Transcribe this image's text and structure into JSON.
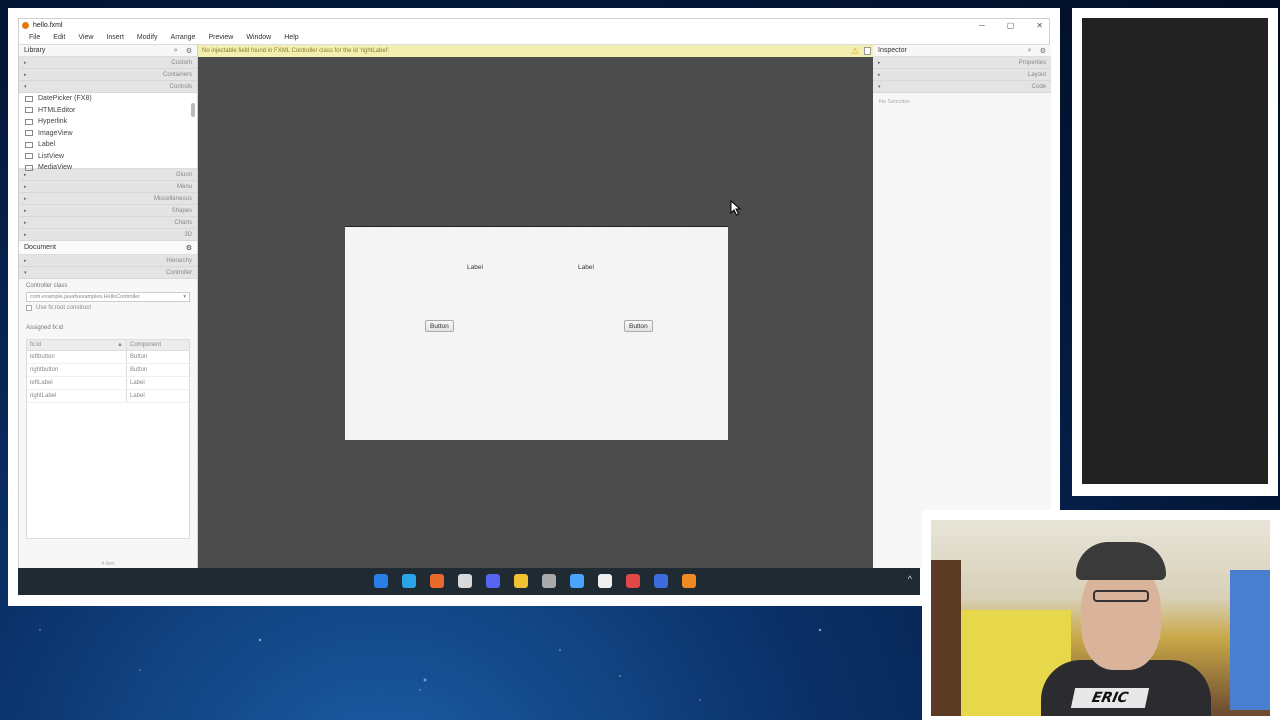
{
  "window": {
    "title": "hello.fxml",
    "controls": {
      "minimize": "─",
      "maximize": "▢",
      "close": "✕"
    }
  },
  "menu": [
    "File",
    "Edit",
    "View",
    "Insert",
    "Modify",
    "Arrange",
    "Preview",
    "Window",
    "Help"
  ],
  "library": {
    "title": "Library",
    "sections_top": [
      "Custom",
      "Containers",
      "Controls"
    ],
    "items": [
      "DatePicker  (FX8)",
      "HTMLEditor",
      "Hyperlink",
      "ImageView",
      "Label",
      "ListView",
      "MediaView"
    ],
    "sections_bottom": [
      "Gluon",
      "Menu",
      "Miscellaneous",
      "Shapes",
      "Charts",
      "3D"
    ]
  },
  "document": {
    "title": "Document",
    "sections": [
      "Hierarchy",
      "Controller"
    ],
    "controller_class_label": "Controller class",
    "controller_class_value": "com.example.javafxexamples.HelloController",
    "fx_root_label": "Use fx:root construct",
    "assigned_fields_label": "Assigned fx:id",
    "table_headers": [
      "fx:id",
      "Component"
    ],
    "rows": [
      [
        "leftbutton",
        "Button"
      ],
      [
        "rightbutton",
        "Button"
      ],
      [
        "leftLabel",
        "Label"
      ],
      [
        "rightLabel",
        "Label"
      ]
    ],
    "footer": "4 item"
  },
  "warning": {
    "text": "No injectable field found in FXML Controller class for the id 'rightLabel'."
  },
  "canvas": {
    "labels": [
      "Label",
      "Label"
    ],
    "buttons": [
      "Button",
      "Button"
    ]
  },
  "inspector": {
    "title": "Inspector",
    "sections": [
      "Properties",
      "Layout",
      "Code"
    ],
    "empty_text": "No Selection"
  },
  "webcam": {
    "name": "ERIC"
  },
  "taskbar": {
    "icon_colors": [
      "#2b7de9",
      "#2aa3e8",
      "#e86a2a",
      "#d9d9d9",
      "#5865f2",
      "#f1c232",
      "#aaaaaa",
      "#4aa3ff",
      "#eeeeee",
      "#e04848",
      "#3c6bdc",
      "#f08a24"
    ]
  }
}
